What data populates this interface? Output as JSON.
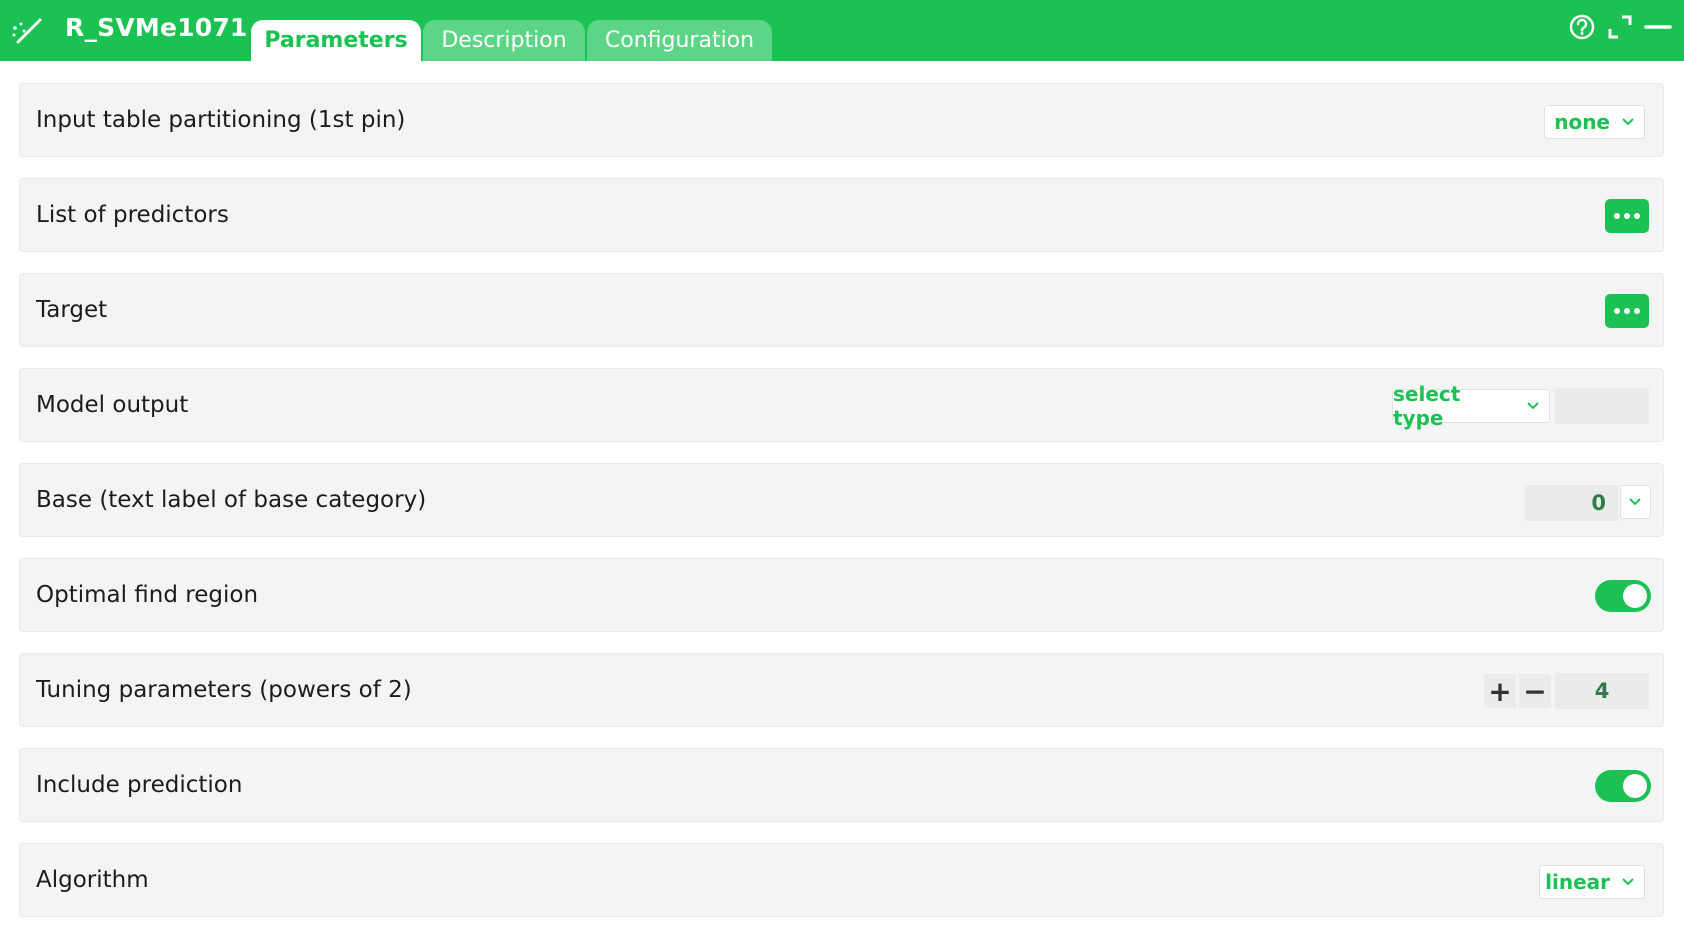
{
  "window": {
    "title": "R_SVMe1071",
    "tabs": [
      {
        "label": "Parameters",
        "active": true
      },
      {
        "label": "Description",
        "active": false
      },
      {
        "label": "Configuration",
        "active": false
      }
    ],
    "icons": [
      "wand-icon",
      "help-icon",
      "expand-icon",
      "minimize-icon"
    ]
  },
  "colors": {
    "brand_green": "#1bc153",
    "tab_inactive": "#5cd587",
    "row_background": "#f3f5f4"
  },
  "params": {
    "partitioning": {
      "label": "Input table partitioning (1st pin)",
      "value": "none"
    },
    "predictors": {
      "label": "List of predictors"
    },
    "target": {
      "label": "Target"
    },
    "model_output": {
      "label": "Model output",
      "type_value": "select type",
      "name_value": ""
    },
    "base": {
      "label": "Base (text label of base category)",
      "value": "0"
    },
    "optimal_find": {
      "label": "Optimal find region",
      "on": true
    },
    "tuning": {
      "label": "Tuning parameters (powers of 2)",
      "value": "4",
      "plus": "+",
      "minus": "−"
    },
    "include_prediction": {
      "label": "Include prediction",
      "on": true
    },
    "algorithm": {
      "label": "Algorithm",
      "value": "linear"
    }
  }
}
